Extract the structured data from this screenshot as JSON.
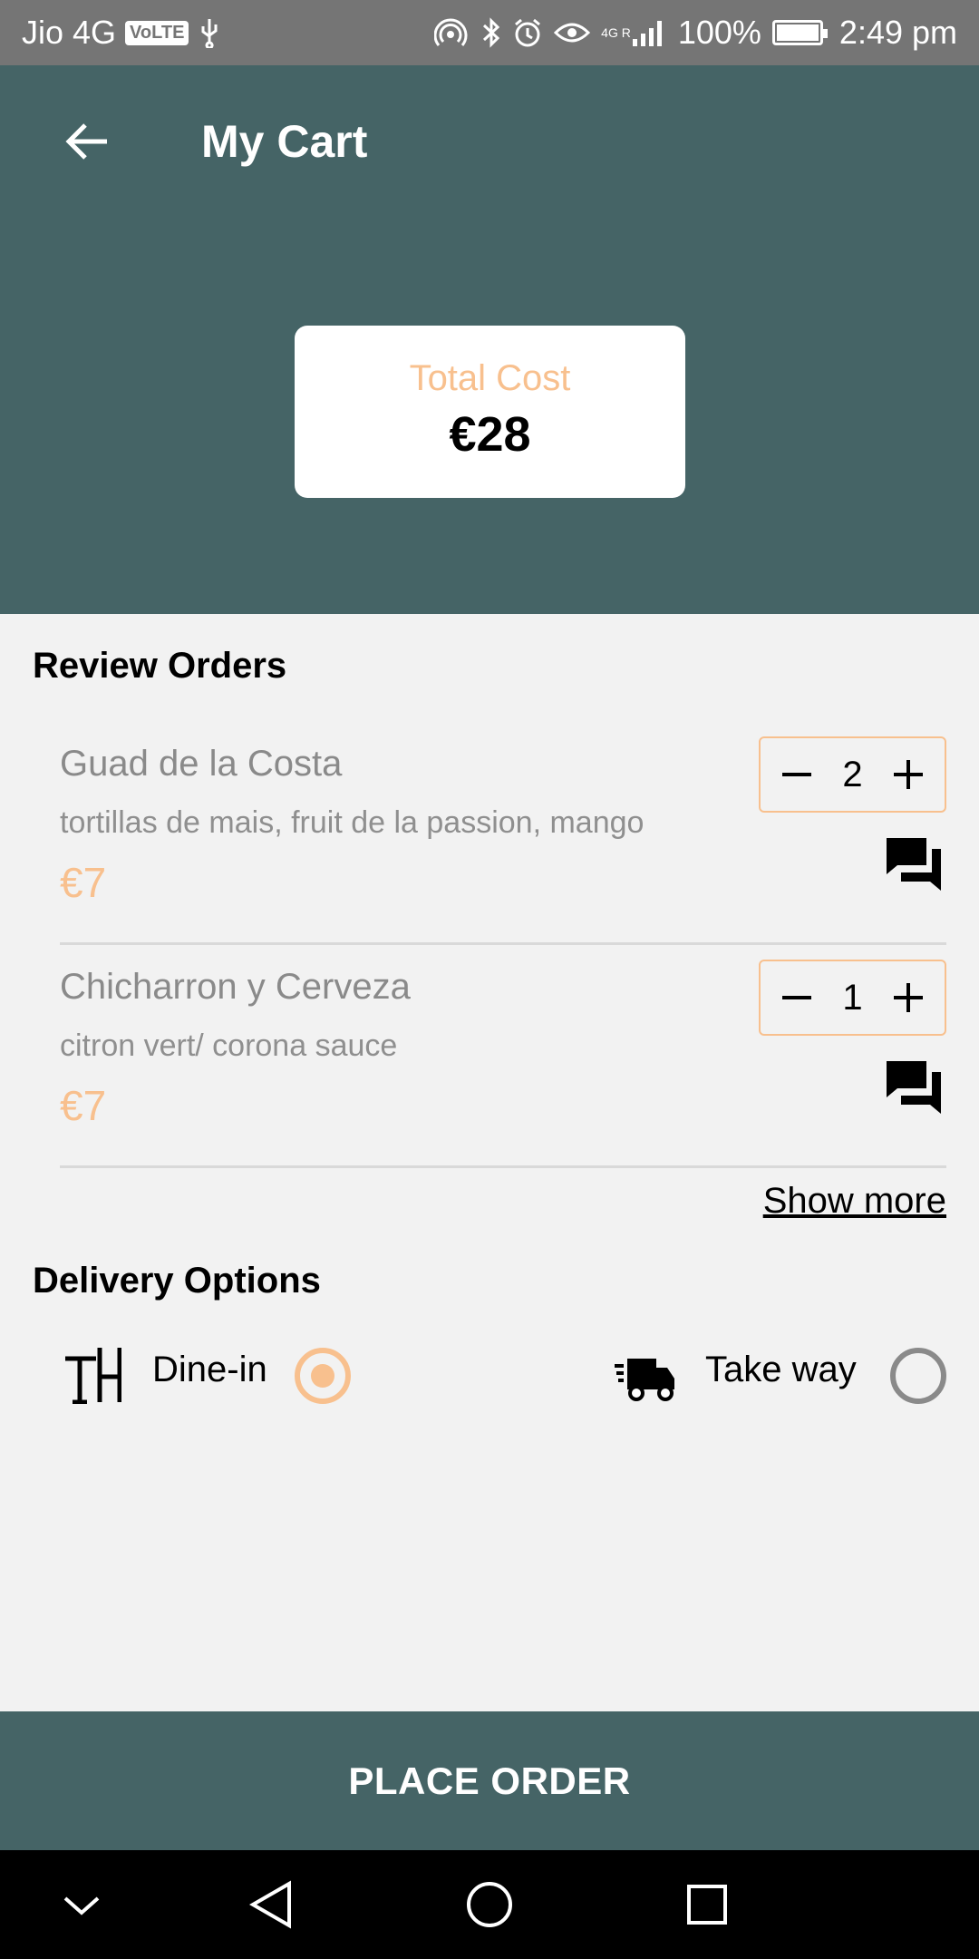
{
  "status_bar": {
    "carrier": "Jio 4G",
    "volte": "VoLTE",
    "network": "4G R",
    "battery_level": 1.0,
    "battery_text": "100%",
    "time": "2:49 pm"
  },
  "header": {
    "title": "My Cart",
    "total_label": "Total Cost",
    "total_value": "€28"
  },
  "review": {
    "title": "Review Orders",
    "items": [
      {
        "name": "Guad de la Costa",
        "description": "tortillas de mais, fruit de la passion, mango",
        "price": "€7",
        "quantity": "2"
      },
      {
        "name": "Chicharron y Cerveza",
        "description": "citron vert/ corona sauce",
        "price": "€7",
        "quantity": "1"
      }
    ],
    "show_more": "Show more"
  },
  "delivery": {
    "title": "Delivery Options",
    "options": [
      {
        "label": "Dine-in",
        "selected": true
      },
      {
        "label": "Take way",
        "selected": false
      }
    ]
  },
  "footer": {
    "place_order": "PLACE ORDER"
  },
  "colors": {
    "header_bg": "#456466",
    "accent": "#f8c08e",
    "page_bg": "#f2f2f2"
  },
  "icons": [
    "back-arrow-icon",
    "minus-icon",
    "plus-icon",
    "chat-icon",
    "table-icon",
    "truck-icon",
    "nav-back-icon",
    "nav-home-icon",
    "nav-recents-icon",
    "nav-chevron-down-icon"
  ]
}
